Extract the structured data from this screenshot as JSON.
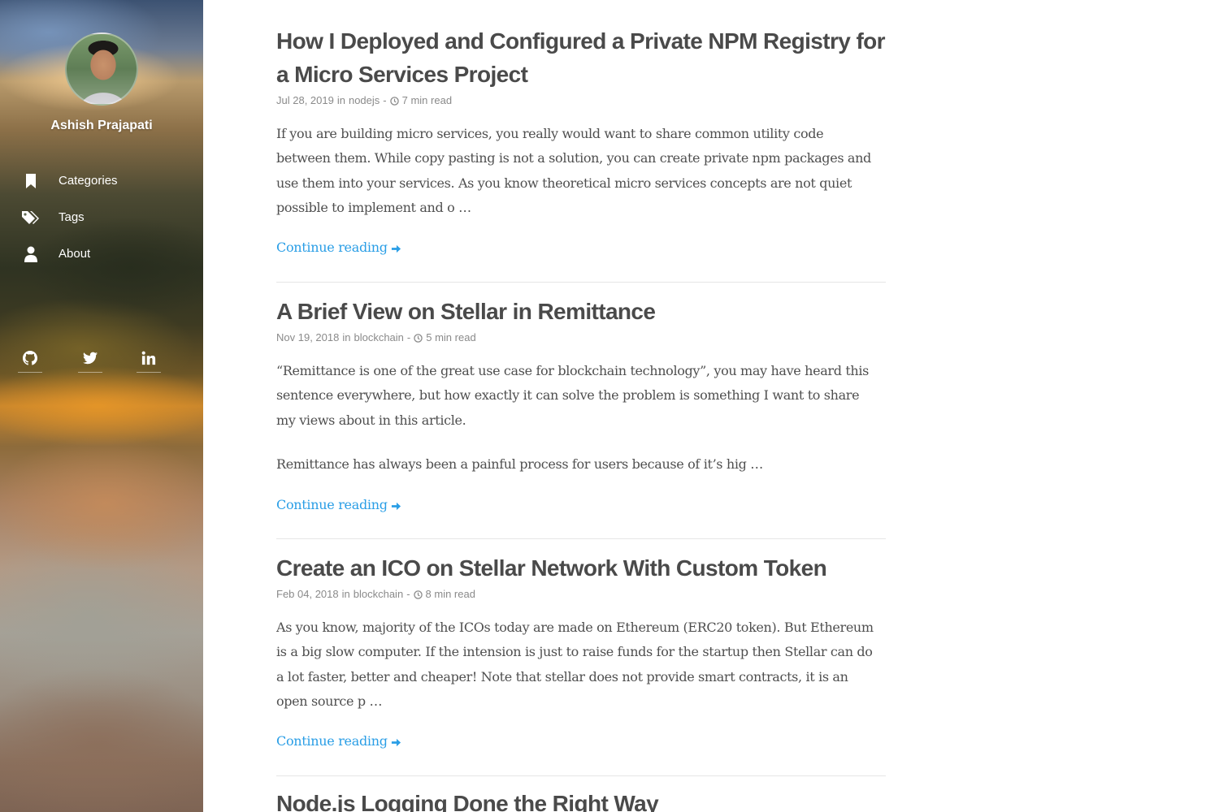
{
  "sidebar": {
    "author_name": "Ashish Prajapati",
    "nav": [
      {
        "label": "Categories",
        "icon": "bookmark-icon"
      },
      {
        "label": "Tags",
        "icon": "tags-icon"
      },
      {
        "label": "About",
        "icon": "user-icon"
      }
    ],
    "social": [
      {
        "name": "github",
        "icon": "github-icon"
      },
      {
        "name": "twitter",
        "icon": "twitter-icon"
      },
      {
        "name": "linkedin",
        "icon": "linkedin-icon"
      }
    ]
  },
  "posts": [
    {
      "title": "How I Deployed and Configured a Private NPM Registry for a Micro Services Project",
      "date": "Jul 28, 2019",
      "in": "in",
      "category": "nodejs",
      "dash": "-",
      "read_time": "7 min read",
      "paragraphs": [
        "If you are building micro services, you really would want to share common utility code between them. While copy pasting is not a solution, you can create private npm packages and use them into your services. As you know theoretical micro services concepts are not quiet possible to implement and o …"
      ],
      "continue_label": "Continue reading"
    },
    {
      "title": "A Brief View on Stellar in Remittance",
      "date": "Nov 19, 2018",
      "in": "in",
      "category": "blockchain",
      "dash": "-",
      "read_time": "5 min read",
      "paragraphs": [
        "“Remittance is one of the great use case for blockchain technology”, you may have heard this sentence everywhere, but how exactly it can solve the problem is something I want to share my views about in this article.",
        "Remittance has always been a painful process for users because of it’s hig …"
      ],
      "continue_label": "Continue reading"
    },
    {
      "title": "Create an ICO on Stellar Network With Custom Token",
      "date": "Feb 04, 2018",
      "in": "in",
      "category": "blockchain",
      "dash": "-",
      "read_time": "8 min read",
      "paragraphs": [
        "As you know, majority of the ICOs today are made on Ethereum (ERC20 token). But Ethereum is a big slow computer. If the intension is just to raise funds for the startup then Stellar can do a lot faster, better and cheaper! Note that stellar does not provide smart contracts, it is an open source p …"
      ],
      "continue_label": "Continue reading"
    },
    {
      "title": "Node.js Logging Done the Right Way"
    }
  ],
  "colors": {
    "link": "#2a9ee6",
    "title": "#4a4a4a",
    "meta": "#8a8a8a",
    "text": "#4f4f4f"
  }
}
